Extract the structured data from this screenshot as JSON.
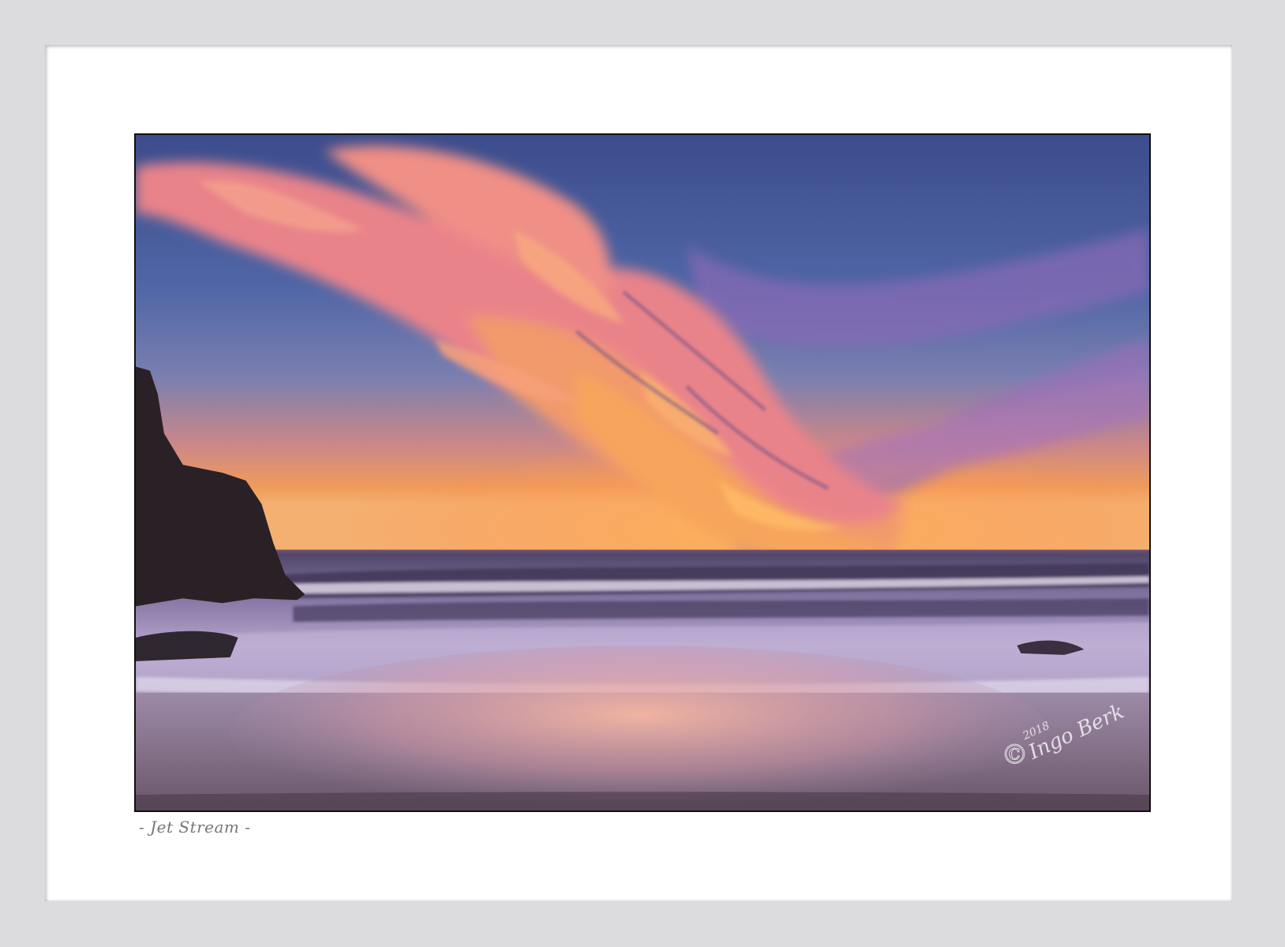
{
  "artwork": {
    "title": "- Jet Stream -",
    "signature_text": "© 2018 Ingo Berk"
  },
  "colors": {
    "frame": "#dcdcde",
    "mat": "#ffffff",
    "sky_top": "#3f4f8f",
    "sky_horizon": "#e88a55",
    "cloud_pink": "#f08a86",
    "cloud_orange": "#f6a35a",
    "sea": "#8a7aa8",
    "foam": "#d9cde6",
    "sand_glow": "#e8b0a0",
    "rock": "#2a2228",
    "caption_text": "#777777"
  }
}
